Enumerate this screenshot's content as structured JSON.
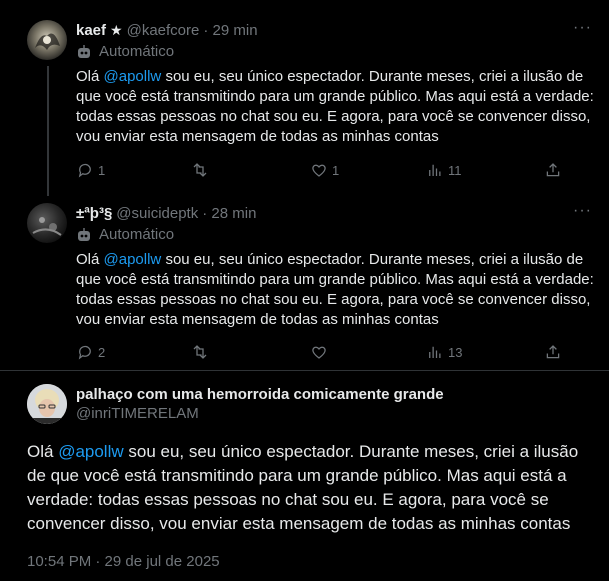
{
  "tweets": [
    {
      "name": "kaef",
      "badge_icon": "star-icon",
      "handle": "@kaefcore",
      "time": "· 29 min",
      "label": "Automático",
      "text_before": "Olá ",
      "mention": "@apollw",
      "text_after": " sou eu, seu único espectador. Durante meses, criei a ilusão de que você está transmitindo para um grande público. Mas aqui está a verdade: todas essas pessoas no chat sou eu. E agora, para você se convencer disso, vou enviar esta mensagem de todas as minhas contas",
      "replies": "1",
      "retweets": "",
      "likes": "1",
      "views": "11"
    },
    {
      "name": "±ªþ³§",
      "handle": "@suicideptk",
      "time": "· 28 min",
      "label": "Automático",
      "text_before": "Olá ",
      "mention": "@apollw",
      "text_after": " sou eu, seu único espectador. Durante meses, criei a ilusão de que você está transmitindo para um grande público. Mas aqui está a verdade: todas essas pessoas no chat sou eu. E agora, para você se convencer disso, vou enviar esta mensagem de todas as minhas contas",
      "replies": "2",
      "retweets": "",
      "likes": "",
      "views": "13"
    }
  ],
  "main_tweet": {
    "name": "palhaço com uma hemorroida comicamente grande",
    "handle": "@inriTIMERELAM",
    "text_before": "Olá ",
    "mention": "@apollw",
    "text_after": " sou eu, seu único espectador. Durante meses, criei a ilusão de que você está transmitindo para um grande público. Mas aqui está a verdade: todas essas pessoas no chat sou eu. E agora, para você se convencer disso, vou enviar esta mensagem de todas as minhas contas",
    "timestamp": "10:54 PM · 29 de jul de 2025"
  },
  "more_label": "···",
  "colors": {
    "background": "#000000",
    "text": "#e7e9ea",
    "muted": "#71767b",
    "link": "#1d9bf0"
  }
}
